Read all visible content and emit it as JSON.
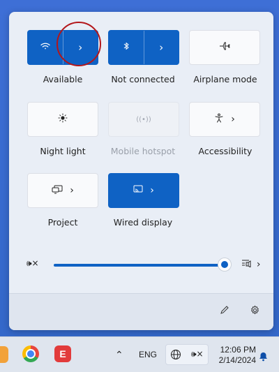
{
  "quick_settings": {
    "tiles": [
      {
        "name": "wifi",
        "label": "Available",
        "state": "on",
        "icon": "wifi-icon"
      },
      {
        "name": "bluetooth",
        "label": "Not connected",
        "state": "on",
        "icon": "bluetooth-icon"
      },
      {
        "name": "airplane",
        "label": "Airplane mode",
        "state": "normal",
        "icon": "airplane-icon"
      },
      {
        "name": "night-light",
        "label": "Night light",
        "state": "normal",
        "icon": "brightness-icon"
      },
      {
        "name": "mobile-hotspot",
        "label": "Mobile hotspot",
        "state": "disabled",
        "icon": "hotspot-icon"
      },
      {
        "name": "accessibility",
        "label": "Accessibility",
        "state": "normal",
        "icon": "accessibility-icon"
      },
      {
        "name": "project",
        "label": "Project",
        "state": "normal",
        "icon": "project-icon"
      },
      {
        "name": "wired-display",
        "label": "Wired display",
        "state": "on",
        "icon": "cast-icon"
      }
    ],
    "volume": {
      "value_percent": 100,
      "muted_icon": "speaker-muted-icon"
    }
  },
  "taskbar": {
    "language": "ENG",
    "time": "12:06 PM",
    "date": "2/14/2024"
  },
  "colors": {
    "accent": "#0f62c4",
    "panel_bg": "#e9eef6",
    "circle": "#b3161a"
  }
}
